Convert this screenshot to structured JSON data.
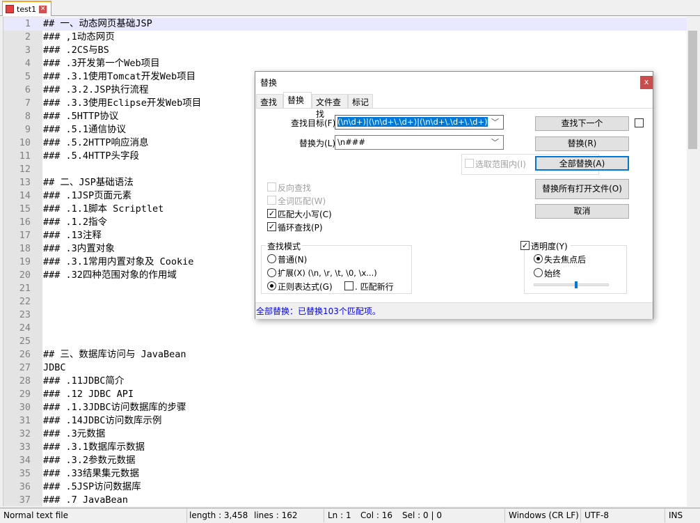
{
  "tab": {
    "name": "test1"
  },
  "editor": {
    "lines": [
      "## 一、动态网页基础JSP",
      "### ,1动态网页",
      "### .2CS与BS",
      "### .3开发第一个Web项目",
      "### .3.1使用Tomcat开发Web项目",
      "### .3.2.JSP执行流程",
      "### .3.3使用Eclipse开发Web项目",
      "### .5HTTP协议",
      "### .5.1通信协议",
      "### .5.2HTTP响应消息",
      "### .5.4HTTP头字段",
      "",
      "## 二、JSP基础语法",
      "### .1JSP页面元素",
      "### .1.1脚本 Scriptlet",
      "### .1.2指令",
      "### .13注释",
      "### .3内置对象",
      "### .3.1常用内置对象及 Cookie",
      "### .32四种范围对象的作用域",
      "",
      "",
      "",
      "",
      "",
      "## 三、数据库访问与 JavaBean",
      "JDBC",
      "### .11JDBC简介",
      "### .12 JDBC API",
      "### .1.3JDBC访问数据库的步骤",
      "### .14JDBC访问数库示例",
      "### .3元数据",
      "### .3.1数据库示数据",
      "### .3.2参数元数据",
      "### .33结果集元数据",
      "### .5JSP访问数据库",
      "### .7 JavaBean"
    ]
  },
  "status": {
    "type": "Normal text file",
    "length": "length : 3,458",
    "lines": "lines : 162",
    "ln": "Ln : 1",
    "col": "Col : 16",
    "sel": "Sel : 0 | 0",
    "eol": "Windows (CR LF)",
    "enc": "UTF-8",
    "mode": "INS"
  },
  "dialog": {
    "title": "替换",
    "close": "x",
    "tabs": [
      "查找",
      "替换",
      "文件查找",
      "标记"
    ],
    "find_label": "查找目标(F) :",
    "find_value": "(\\n\\d+)|(\\n\\d+\\.\\d+)|(\\n\\d+\\.\\d+\\.\\d+)",
    "replace_label": "替换为(L) :",
    "replace_value": "\\n###",
    "btn_find_next": "查找下一个",
    "btn_replace": "替换(R)",
    "btn_replace_all": "全部替换(A)",
    "btn_replace_all_open": "替换所有打开文件(O)",
    "btn_cancel": "取消",
    "in_selection": "选取范围内(I)",
    "opt_backward": "反向查找",
    "opt_whole_word": "全词匹配(W)",
    "opt_match_case": "匹配大小写(C)",
    "opt_wrap": "循环查找(P)",
    "mode_title": "查找模式",
    "mode_normal": "普通(N)",
    "mode_extended": "扩展(X) (\\n, \\r, \\t, \\0, \\x...)",
    "mode_regex": "正则表达式(G)",
    "dot_newline": ". 匹配新行",
    "transparency": "透明度(Y)",
    "trans_on_lose_focus": "失去焦点后",
    "trans_always": "始终",
    "transparency_level": 0.55,
    "status_msg": "全部替换：已替换103个匹配项。"
  }
}
